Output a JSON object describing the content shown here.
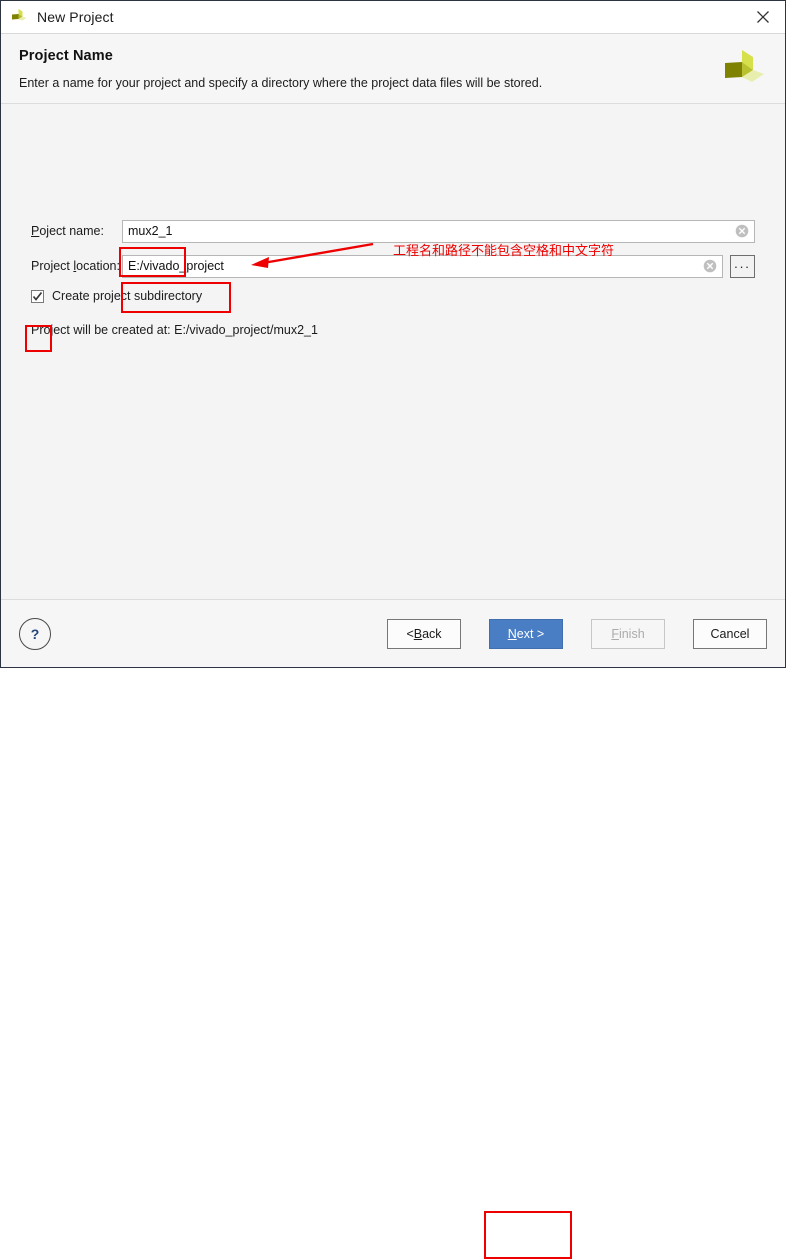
{
  "titlebar": {
    "title": "New Project",
    "app_icon": "xilinx-logo-icon",
    "close_icon": "close-icon"
  },
  "header": {
    "title": "Project Name",
    "subtitle": "Enter a name for your project and specify a directory where the project data files will be stored.",
    "logo_icon": "xilinx-logo-icon"
  },
  "form": {
    "project_name": {
      "label_pre": "P",
      "label_key": "r",
      "label_post": "oject name:",
      "label": "Project name:",
      "value": "mux2_1",
      "placeholder": "",
      "clear_icon": "clear-circle-icon"
    },
    "project_location": {
      "label_pre": "Project ",
      "label_key": "l",
      "label_post": "ocation:",
      "label": "Project location:",
      "value": "E:/vivado_project",
      "placeholder": "",
      "clear_icon": "clear-circle-icon",
      "browse_label": "...",
      "browse_icon": "ellipsis-icon"
    },
    "create_subdirectory": {
      "label": "Create project subdirectory",
      "checked": true,
      "check_icon": "checkmark-icon"
    },
    "created_at_text": "Project will be created at: E:/vivado_project/mux2_1"
  },
  "annotations": {
    "note_text": "工程名和路径不能包含空格和中文字符",
    "color": "#ee0000",
    "arrow_icon": "arrow-left-icon",
    "highlight_boxes": [
      "project-name-field",
      "project-location-field",
      "create-subdirectory-checkbox",
      "next-button"
    ]
  },
  "footer": {
    "help_label": "?",
    "help_icon": "question-mark-icon",
    "buttons": [
      {
        "id": "back",
        "label_pre": "< ",
        "label_key": "B",
        "label_post": "ack",
        "label": "< Back",
        "state": "enabled"
      },
      {
        "id": "next",
        "label_pre": "",
        "label_key": "N",
        "label_post": "ext >",
        "label": "Next >",
        "state": "primary"
      },
      {
        "id": "finish",
        "label_pre": "",
        "label_key": "F",
        "label_post": "inish",
        "label": "Finish",
        "state": "disabled"
      },
      {
        "id": "cancel",
        "label_pre": "",
        "label_key": "",
        "label_post": "Cancel",
        "label": "Cancel",
        "state": "enabled"
      }
    ]
  },
  "colors": {
    "accent_blue": "#4a7ec4",
    "annotation_red": "#ee0000",
    "logo_olive": "#7f8200",
    "logo_yellow": "#d6e04a",
    "logo_light": "#e8eeae",
    "dialog_bg": "#f4f4f4"
  }
}
